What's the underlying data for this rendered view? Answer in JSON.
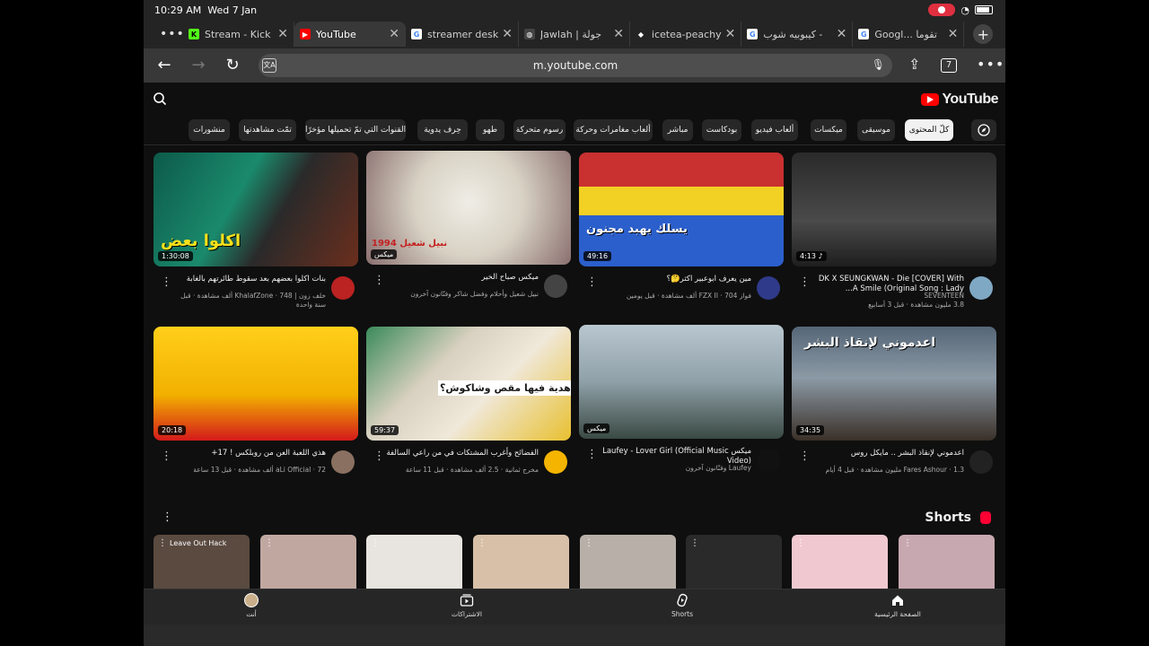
{
  "status": {
    "time": "10:29 AM",
    "date": "Wed 7 Jan"
  },
  "tabs": [
    {
      "title": "Stream - Kick",
      "fav": "K",
      "favbg": "#53fc18",
      "favfg": "#000"
    },
    {
      "title": "YouTube",
      "fav": "▶",
      "favbg": "#ff0000",
      "favfg": "#fff"
    },
    {
      "title": "streamer desk",
      "fav": "G",
      "favbg": "#ffffff",
      "favfg": "#4285f4"
    },
    {
      "title": "Jawlah | جولة",
      "fav": "◍",
      "favbg": "#444",
      "favfg": "#fff"
    },
    {
      "title": "icetea-peachy",
      "fav": "◆",
      "favbg": "#242424",
      "favfg": "#fff"
    },
    {
      "title": "كيبوبيه شوب -",
      "fav": "G",
      "favbg": "#ffffff",
      "favfg": "#4285f4"
    },
    {
      "title": "Googl... تقوما",
      "fav": "G",
      "favbg": "#ffffff",
      "favfg": "#4285f4"
    }
  ],
  "address": {
    "url": "m.youtube.com",
    "tab_count": "7"
  },
  "yt": {
    "logo_text": "YouTube"
  },
  "chips": [
    "كلّ المحتوى",
    "موسيقى",
    "ميكسات",
    "ألعاب فيديو",
    "بودكاست",
    "مباشر",
    "ألعاب مغامرات وحركة",
    "رسوم متحركة",
    "طهو",
    "حِرف يدوية",
    "القنوات التي تمّ تحميلها مؤخرًا",
    "تمّت مشاهدتها",
    "منشورات"
  ],
  "videos": [
    {
      "title": "DK X SEUNGKWAN - Die [COVER] With A Smile (Original Song : Lady...",
      "meta": "SEVENTEEN",
      "meta2": "3.8 مليون مشاهدة · قبل 3 أسابيع",
      "duration": "4:13 ♪",
      "thumb_text": ""
    },
    {
      "title": "مين يعرف ابوعبير اكثر🤔؟",
      "meta": "فواز FZX II · 704 ألف مشاهدة · قبل يومين",
      "meta2": "",
      "duration": "49:16",
      "thumb_text": "يسلك يهبد مجنون"
    },
    {
      "title": "ميكس صباح الخير",
      "meta": "نبيل شعيل وأحلام وفضل شاكر وفنّانون آخرون",
      "meta2": "",
      "duration": "ميكس",
      "thumb_text": "نبيل شعيل 1994"
    },
    {
      "title": "بنات اكلوا بعضهم بعد سقوط طائرتهم بالغابة",
      "meta": "خلف زون | KhalafZone · 748 ألف مشاهدة · قبل",
      "meta2": "سنة واحدة",
      "duration": "1:30:08",
      "thumb_text": "اكلوا بعض"
    },
    {
      "title": "اعدموني لإنقاذ البشر .. مايكل روس",
      "meta": "Fares Ashour · 1.3 مليون مشاهدة · قبل 4 أيام",
      "meta2": "",
      "duration": "34:35",
      "thumb_text": "اعدموني لإنقاذ البشر"
    },
    {
      "title": "ميكس Laufey - Lover Girl (Official Music Video)",
      "meta": "Laufey وفنّانون آخرون",
      "meta2": "",
      "duration": "ميكس",
      "thumb_text": ""
    },
    {
      "title": "الفضائح وأغرب المشتكات في من راعي السالفة",
      "meta": "مخرج ثمانية · 2.5 ألف مشاهدة · قبل 11 ساعة",
      "meta2": "",
      "duration": "59:37",
      "thumb_text": "من جاه هدية فيها مقص وشاكوش؟"
    },
    {
      "title": "هذي اللعبة العن من روبلكس ! 17+",
      "meta": "aLi Official · 72 ألف مشاهدة · قبل 13 ساعة",
      "meta2": "",
      "duration": "20:18",
      "thumb_text": ""
    }
  ],
  "shorts": {
    "label": "Shorts",
    "first_overlay": "Leave Out Hack"
  },
  "bottom_nav": {
    "home": "الصفحة الرئيسية",
    "shorts": "Shorts",
    "subs": "الاشتراكات",
    "you": "أنت"
  }
}
